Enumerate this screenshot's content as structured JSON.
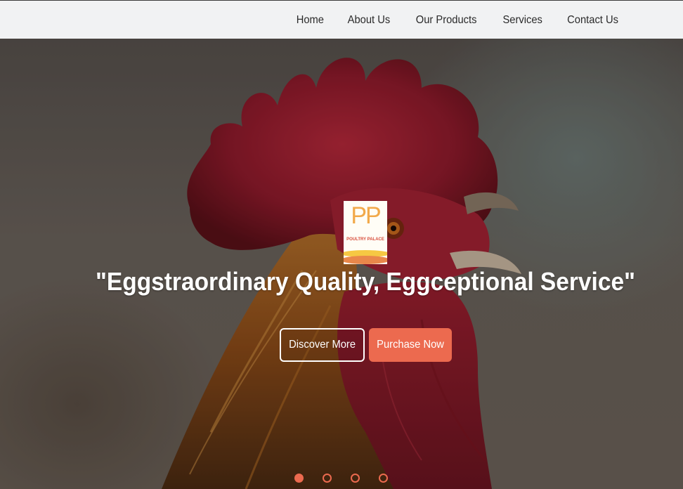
{
  "nav": {
    "items": [
      {
        "label": "Home"
      },
      {
        "label": "About Us"
      },
      {
        "label": "Our Products"
      },
      {
        "label": "Services"
      },
      {
        "label": "Contact Us"
      }
    ]
  },
  "hero": {
    "logo": {
      "letters": "PP",
      "subtitle": "POULTRY PALACE"
    },
    "tagline": "\"Eggstraordinary Quality, Eggceptional Service\"",
    "buttons": {
      "discover": "Discover More",
      "purchase": "Purchase Now"
    },
    "slides": {
      "count": 4,
      "active_index": 0
    },
    "background_image": "rooster-close-up"
  },
  "colors": {
    "accent": "#ec6a4f",
    "navbar_bg": "#f1f2f3",
    "text_light": "#ffffff"
  }
}
